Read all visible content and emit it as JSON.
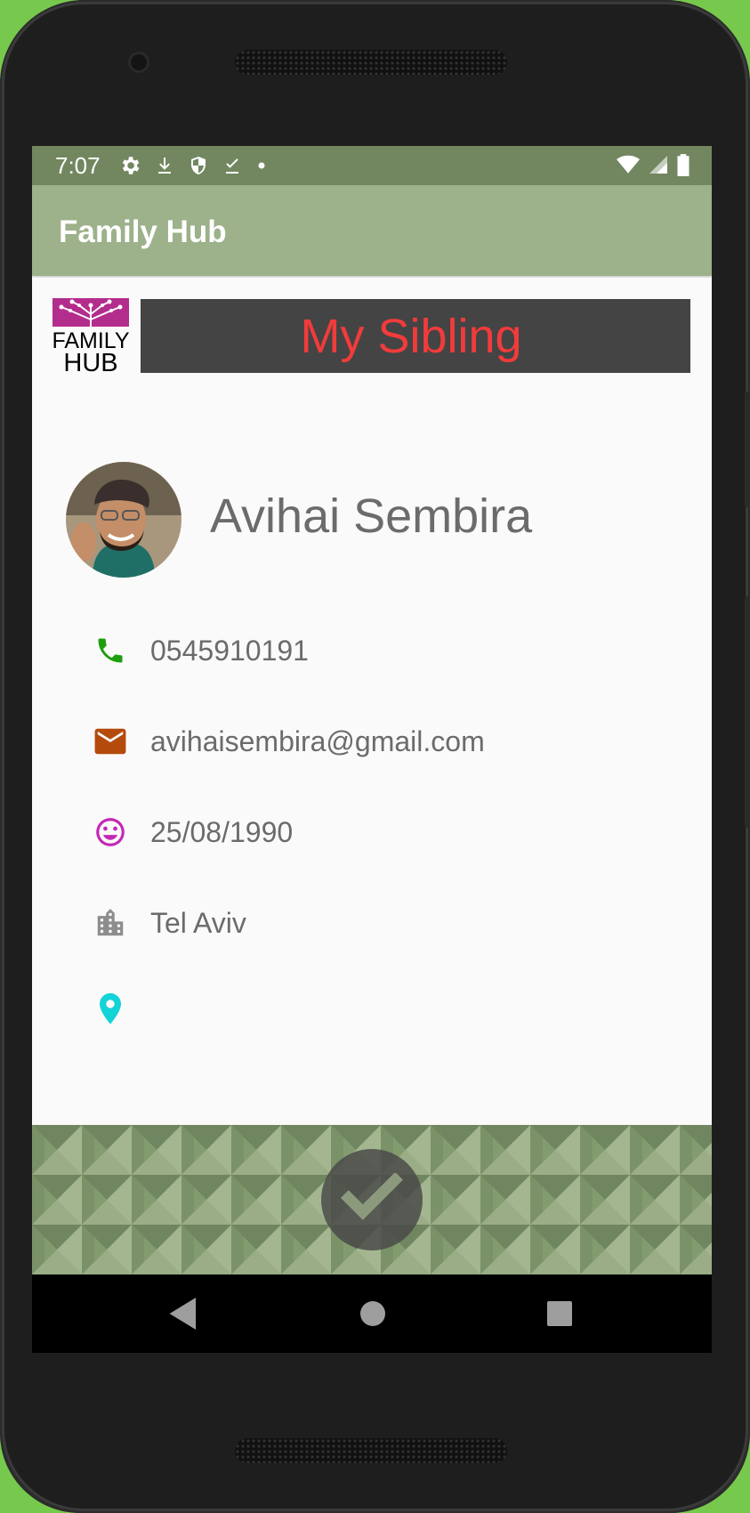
{
  "status_bar": {
    "time": "7:07",
    "icons_left": [
      "gear-icon",
      "download-icon",
      "shield-icon",
      "checkmark-download-icon",
      "dot-icon"
    ],
    "icons_right": [
      "wifi-icon",
      "cell-signal-icon",
      "battery-icon"
    ]
  },
  "app_bar": {
    "title": "Family Hub"
  },
  "header": {
    "logo_text_line1": "FAMILY",
    "logo_text_line2": "HUB",
    "banner_title": "My Sibling",
    "banner_color": "#f23b3b"
  },
  "contact": {
    "name": "Avihai Sembira",
    "phone": "0545910191",
    "email": "avihaisembira@gmail.com",
    "birthday": "25/08/1990",
    "city": "Tel Aviv",
    "location": ""
  },
  "colors": {
    "phone_icon": "#1e9e0f",
    "email_icon": "#b44b0c",
    "birthday_icon": "#c228b6",
    "city_icon": "#8d8d8d",
    "location_icon": "#11d3d8",
    "status_bar": "#728760",
    "app_bar": "#9db18a"
  },
  "fab": {
    "icon": "checkmark-icon"
  },
  "nav_bar": {
    "buttons": [
      "back-icon",
      "home-icon",
      "recents-icon"
    ]
  }
}
